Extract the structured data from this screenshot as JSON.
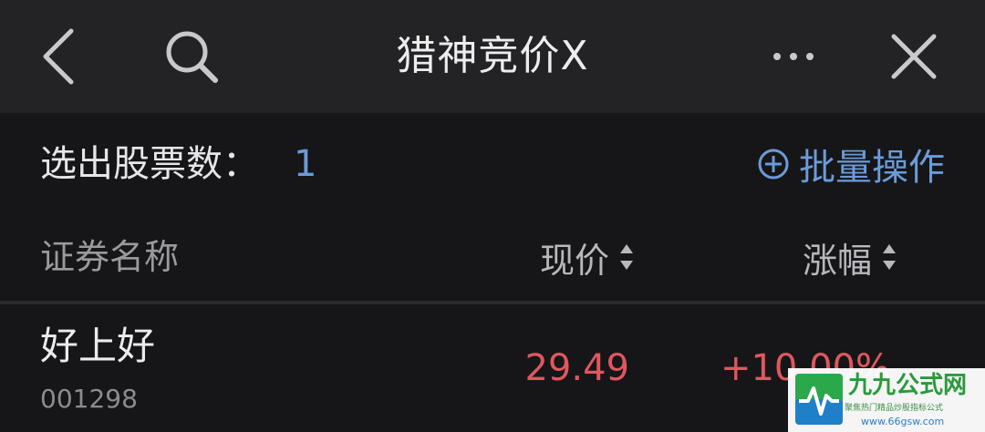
{
  "header": {
    "title": "猎神竞价X",
    "back_icon": "chevron-left-icon",
    "search_icon": "search-icon",
    "more_icon": "more-horizontal-icon",
    "close_icon": "close-icon"
  },
  "summary": {
    "count_label": "选出股票数：",
    "count_value": "1",
    "batch_action_label": "批量操作",
    "batch_action_icon": "plus-circle-icon"
  },
  "table": {
    "columns": {
      "name": "证券名称",
      "price": "现价",
      "change": "涨幅"
    },
    "rows": [
      {
        "name": "好上好",
        "code": "001298",
        "price": "29.49",
        "change": "+10.00%"
      }
    ]
  },
  "watermark": {
    "title": "九九公式网",
    "subtitle": "聚焦热门精品炒股指标公式",
    "url": "www.66gsw.com"
  },
  "colors": {
    "background": "#161618",
    "header_background": "#232325",
    "accent_blue": "#6b9bd8",
    "rise_red": "#e0575f"
  }
}
